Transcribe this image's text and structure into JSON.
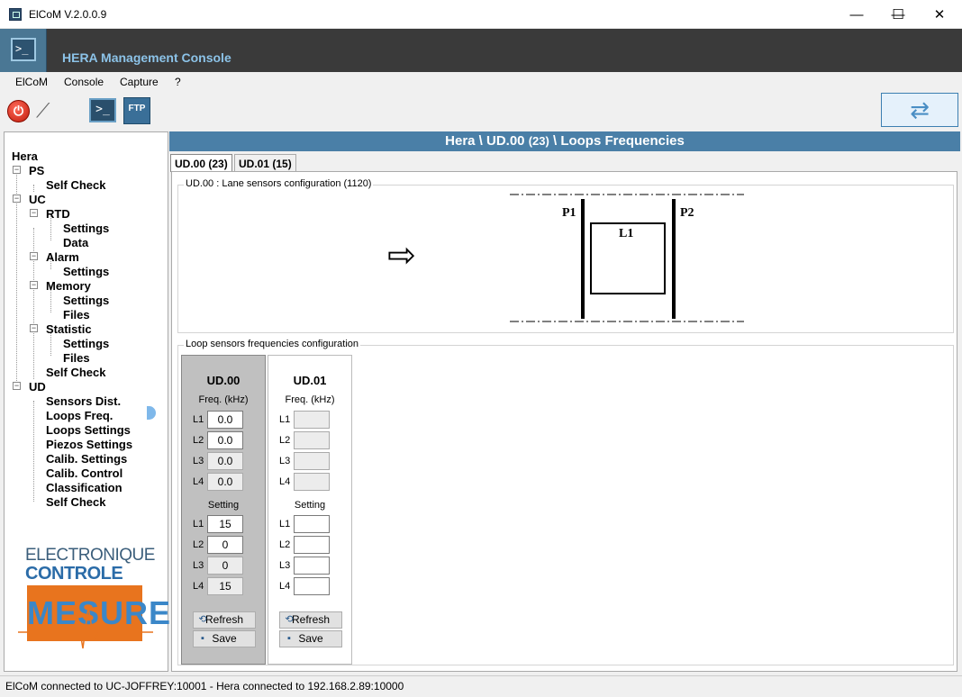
{
  "window": {
    "title": "ElCoM V.2.0.0.9",
    "minimize_glyph": "—",
    "maximize_glyph": "☐",
    "close_glyph": "✕"
  },
  "banner": {
    "title": "HERA Management Console",
    "console_glyph": ">_"
  },
  "menu": {
    "items": [
      "ElCoM",
      "Console",
      "Capture",
      "?"
    ]
  },
  "toolbar": {
    "power_icon": "power-icon",
    "plug_icon": "plug-icon",
    "console_label": ">_",
    "ftp_label": "FTP",
    "sync_icon": "sync-icon",
    "power_glyph": "⏻",
    "plug_glyph": "⟋",
    "sync_glyph": "⇄"
  },
  "tree": {
    "root": "Hera",
    "nodes": [
      "PS",
      "Self Check",
      "UC",
      "RTD",
      "Settings",
      "Data",
      "Alarm",
      "Settings",
      "Memory",
      "Settings",
      "Files",
      "Statistic",
      "Settings",
      "Files",
      "Self Check",
      "UD",
      "Sensors Dist.",
      "Loops Freq.",
      "Loops Settings",
      "Piezos Settings",
      "Calib. Settings",
      "Calib. Control",
      "Classification",
      "Self Check"
    ]
  },
  "logo": {
    "line1": "ELECTRONIQUE",
    "line2": "CONTROLE",
    "line3": "MESURE"
  },
  "main": {
    "header_part1": "Hera \\ UD.00 ",
    "header_count": "(23)",
    "header_part2": " \\ Loops Frequencies",
    "tabs": [
      "UD.00 (23)",
      "UD.01 (15)"
    ],
    "lane_group_title": "UD.00 : Lane sensors configuration (1120)",
    "loop_group_title": "Loop sensors frequencies configuration",
    "diagram": {
      "p1": "P1",
      "p2": "P2",
      "loop": "L1",
      "arrow_glyph": "⇨"
    }
  },
  "ud_columns": [
    {
      "title": "UD.00",
      "freq_caption": "Freq. (kHz)",
      "freq": [
        {
          "label": "L1",
          "value": "0.0"
        },
        {
          "label": "L2",
          "value": "0.0"
        },
        {
          "label": "L3",
          "value": "0.0"
        },
        {
          "label": "L4",
          "value": "0.0"
        }
      ],
      "setting_caption": "Setting",
      "setting": [
        {
          "label": "L1",
          "value": "15"
        },
        {
          "label": "L2",
          "value": "0"
        },
        {
          "label": "L3",
          "value": "0"
        },
        {
          "label": "L4",
          "value": "15"
        }
      ],
      "refresh_label": "Refresh",
      "save_label": "Save"
    },
    {
      "title": "UD.01",
      "freq_caption": "Freq. (kHz)",
      "freq": [
        {
          "label": "L1",
          "value": ""
        },
        {
          "label": "L2",
          "value": ""
        },
        {
          "label": "L3",
          "value": ""
        },
        {
          "label": "L4",
          "value": ""
        }
      ],
      "setting_caption": "Setting",
      "setting": [
        {
          "label": "L1",
          "value": ""
        },
        {
          "label": "L2",
          "value": ""
        },
        {
          "label": "L3",
          "value": ""
        },
        {
          "label": "L4",
          "value": ""
        }
      ],
      "refresh_label": "Refresh",
      "save_label": "Save"
    }
  ],
  "status": {
    "text": "ElCoM connected to UC-JOFFREY:10001  -  Hera connected to 192.168.2.89:10000"
  }
}
